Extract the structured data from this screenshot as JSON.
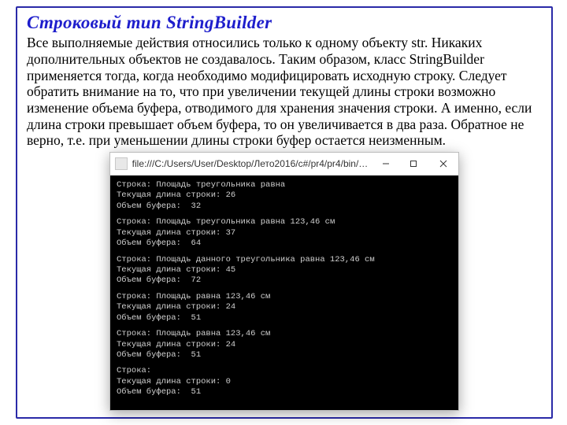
{
  "title": "Строковый тип StringBuilder",
  "body": "Все выполняемые действия относились только к одному объекту str. Никаких дополнительных объектов не создавалось. Таким образом, класс StringBuilder  применяется тогда, когда необходимо модифицировать исходную строку. Следует обратить внимание на то, что при увеличении текущей длины строки возможно изменение объема буфера, отводимого для хранения значения строки. А именно, если длина строки превышает объем буфера, то он увеличивается в два раза. Обратное не верно, т.е. при уменьшении длины строки буфер остается неизменным.",
  "console": {
    "title": "file:///C:/Users/User/Desktop/Лето2016/c#/pr4/pr4/bin/De...",
    "blocks": [
      {
        "l1": "Строка: Площадь треугольника равна",
        "l2": "Текущая длина строки: 26",
        "l3": "Объем буфера:  32"
      },
      {
        "l1": "Строка: Площадь треугольника равна 123,46 см",
        "l2": "Текущая длина строки: 37",
        "l3": "Объем буфера:  64"
      },
      {
        "l1": "Строка: Площадь данного треугольника равна 123,46 см",
        "l2": "Текущая длина строки: 45",
        "l3": "Объем буфера:  72"
      },
      {
        "l1": "Строка: Площадь равна 123,46 см",
        "l2": "Текущая длина строки: 24",
        "l3": "Объем буфера:  51"
      },
      {
        "l1": "Строка: Площадь равна 123,46 см",
        "l2": "Текущая длина строки: 24",
        "l3": "Объем буфера:  51"
      },
      {
        "l1": "Строка:",
        "l2": "Текущая длина строки: 0",
        "l3": "Объем буфера:  51"
      }
    ]
  }
}
